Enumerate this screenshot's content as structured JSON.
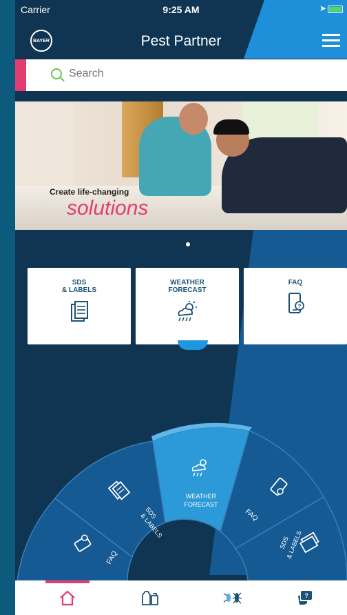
{
  "status_bar": {
    "carrier": "Carrier",
    "time": "9:25 AM"
  },
  "header": {
    "logo_text": "BAYER",
    "title": "Pest Partner",
    "menu_icon": "hamburger-menu-icon"
  },
  "search": {
    "placeholder": "Search",
    "value": ""
  },
  "banner": {
    "tagline": "Create life-changing",
    "headline": "solutions"
  },
  "tiles": [
    {
      "label_line1": "SDS",
      "label_line2": "& LABELS",
      "icon": "document-icon"
    },
    {
      "label_line1": "WEATHER",
      "label_line2": "FORECAST",
      "icon": "weather-icon"
    },
    {
      "label_line1": "FAQ",
      "label_line2": "",
      "icon": "phone-faq-icon"
    }
  ],
  "wheel": {
    "segments": [
      {
        "label": "FAQ",
        "icon": "phone-faq-icon"
      },
      {
        "label": "SDS",
        "label2": "& LABELS",
        "icon": "document-icon"
      },
      {
        "label": "WEATHER",
        "label2": "FORECAST",
        "icon": "weather-icon",
        "selected": true
      },
      {
        "label": "FAQ",
        "icon": "phone-faq-icon"
      },
      {
        "label": "SDS",
        "label2": "& LABELS",
        "icon": "document-icon"
      }
    ]
  },
  "tabbar": {
    "tabs": [
      {
        "icon": "home-icon",
        "active": true
      },
      {
        "icon": "products-icon",
        "active": false
      },
      {
        "icon": "pests-icon",
        "active": false
      },
      {
        "icon": "chat-icon",
        "active": false
      }
    ]
  },
  "colors": {
    "brand_pink": "#e23d70",
    "brand_blue": "#1e8fd9",
    "dark_navy": "#0f3553",
    "wheel_dark": "#155a93",
    "wheel_selected": "#2c9ad8",
    "search_green": "#6cc24a"
  }
}
